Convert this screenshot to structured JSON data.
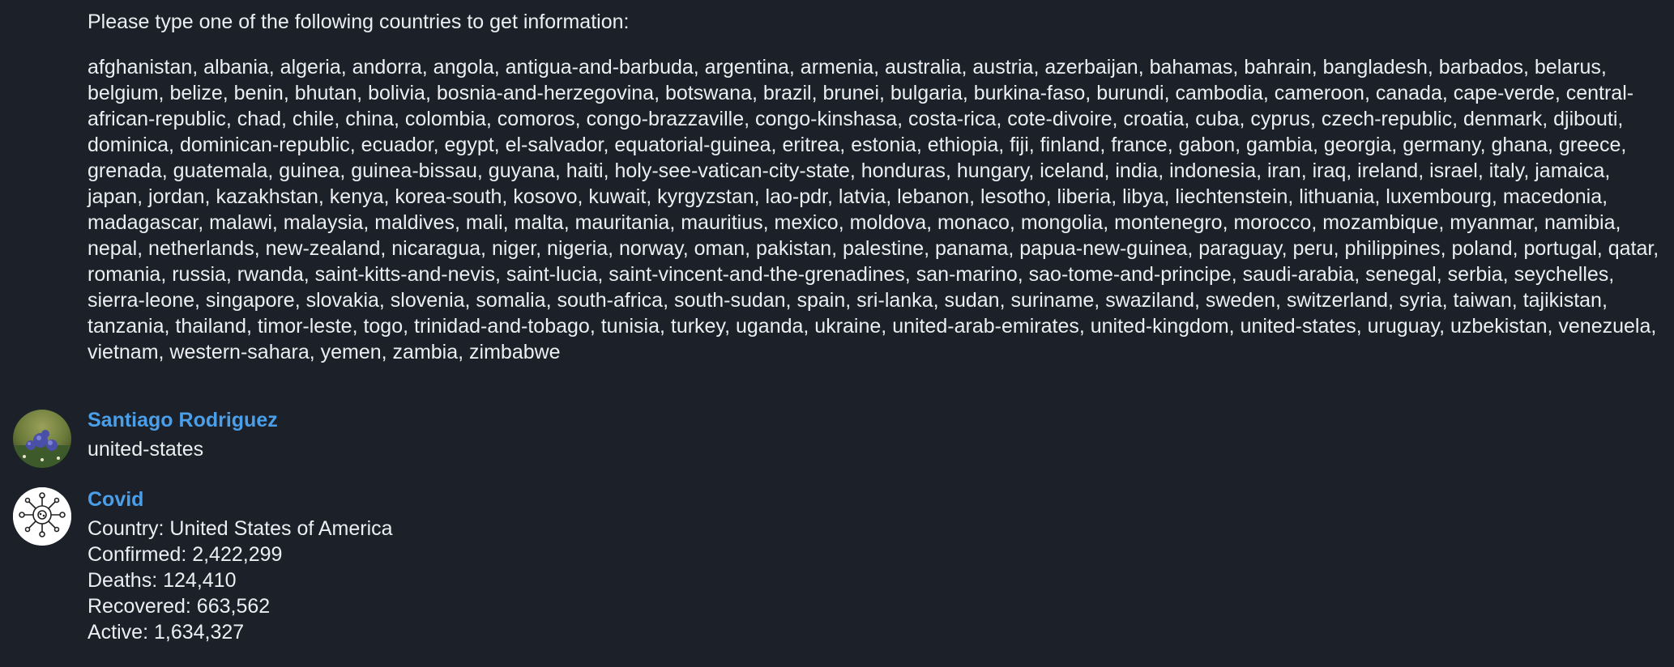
{
  "messages": {
    "prompt": {
      "intro": "Please type one of the following countries to get information:",
      "countries": "afghanistan, albania, algeria, andorra, angola, antigua-and-barbuda, argentina, armenia, australia, austria, azerbaijan, bahamas, bahrain, bangladesh, barbados, belarus, belgium, belize, benin, bhutan, bolivia, bosnia-and-herzegovina, botswana, brazil, brunei, bulgaria, burkina-faso, burundi, cambodia, cameroon, canada, cape-verde, central-african-republic, chad, chile, china, colombia, comoros, congo-brazzaville, congo-kinshasa, costa-rica, cote-divoire, croatia, cuba, cyprus, czech-republic, denmark, djibouti, dominica, dominican-republic, ecuador, egypt, el-salvador, equatorial-guinea, eritrea, estonia, ethiopia, fiji, finland, france, gabon, gambia, georgia, germany, ghana, greece, grenada, guatemala, guinea, guinea-bissau, guyana, haiti, holy-see-vatican-city-state, honduras, hungary, iceland, india, indonesia, iran, iraq, ireland, israel, italy, jamaica, japan, jordan, kazakhstan, kenya, korea-south, kosovo, kuwait, kyrgyzstan, lao-pdr, latvia, lebanon, lesotho, liberia, libya, liechtenstein, lithuania, luxembourg, macedonia, madagascar, malawi, malaysia, maldives, mali, malta, mauritania, mauritius, mexico, moldova, monaco, mongolia, montenegro, morocco, mozambique, myanmar, namibia, nepal, netherlands, new-zealand, nicaragua, niger, nigeria, norway, oman, pakistan, palestine, panama, papua-new-guinea, paraguay, peru, philippines, poland, portugal, qatar, romania, russia, rwanda, saint-kitts-and-nevis, saint-lucia, saint-vincent-and-the-grenadines, san-marino, sao-tome-and-principe, saudi-arabia, senegal, serbia, seychelles, sierra-leone, singapore, slovakia, slovenia, somalia, south-africa, south-sudan, spain, sri-lanka, sudan, suriname, swaziland, sweden, switzerland, syria, taiwan, tajikistan, tanzania, thailand, timor-leste, togo, trinidad-and-tobago, tunisia, turkey, uganda, ukraine, united-arab-emirates, united-kingdom, united-states, uruguay, uzbekistan, venezuela, vietnam, western-sahara, yemen, zambia, zimbabwe"
    },
    "user": {
      "author": "Santiago Rodriguez",
      "text": "united-states"
    },
    "bot": {
      "author": "Covid",
      "lines": [
        "Country: United States of America",
        "Confirmed: 2,422,299",
        "Deaths: 124,410",
        "Recovered: 663,562",
        "Active: 1,634,327"
      ]
    }
  },
  "colors": {
    "background": "#1b2029",
    "author_name": "#4a9fe8",
    "text": "#eceef1"
  },
  "icons": {
    "user_avatar": "flower-photo-avatar",
    "bot_avatar": "virus-icon"
  }
}
